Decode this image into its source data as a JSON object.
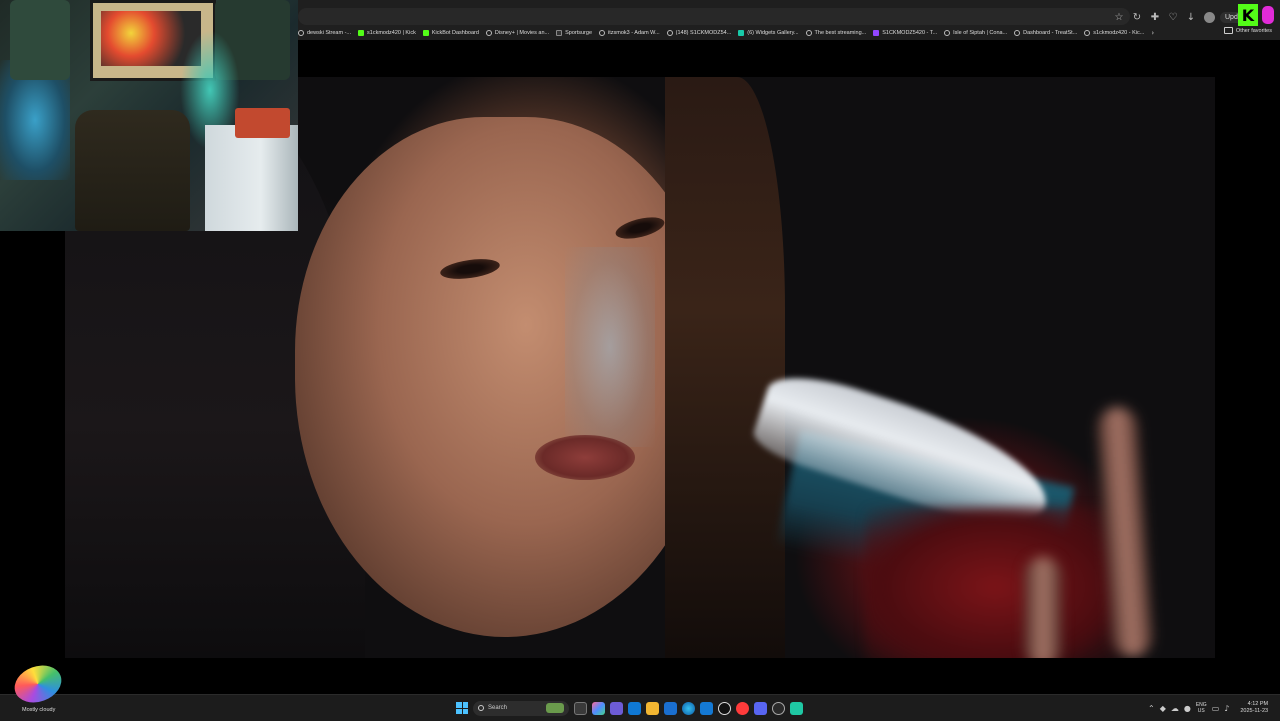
{
  "browser": {
    "update_label": "Upd",
    "kick_logo": "K",
    "bookmarks": [
      {
        "label": "dewski Stream -...",
        "icon": "globe"
      },
      {
        "label": "s1ckmodz420 | Kick",
        "icon": "kick"
      },
      {
        "label": "KickBot Dashboard",
        "icon": "kick"
      },
      {
        "label": "Disney+ | Movies an...",
        "icon": "globe"
      },
      {
        "label": "Sportsurge",
        "icon": "sportsurge"
      },
      {
        "label": "itzsmok3 - Adam W...",
        "icon": "globe"
      },
      {
        "label": "(148) S1CKMODZ54...",
        "icon": "globe"
      },
      {
        "label": "(6) Widgets Gallery...",
        "icon": "widgets"
      },
      {
        "label": "The best streaming...",
        "icon": "globe"
      },
      {
        "label": "S1CKMODZ5420 - T...",
        "icon": "twitch"
      },
      {
        "label": "Isle of Siptah | Cona...",
        "icon": "globe"
      },
      {
        "label": "Dashboard - TreatSt...",
        "icon": "globe"
      },
      {
        "label": "s1ckmodz420 - Kic...",
        "icon": "globe"
      }
    ],
    "other_favorites": "Other favorites"
  },
  "video": {
    "description_alt": "movie frame"
  },
  "taskbar": {
    "weather": "Mostly cloudy",
    "search_label": "Search",
    "language_line1": "ENG",
    "language_line2": "US",
    "time": "4:12 PM",
    "date": "2025-11-23",
    "accent": "#4cc2ff"
  }
}
